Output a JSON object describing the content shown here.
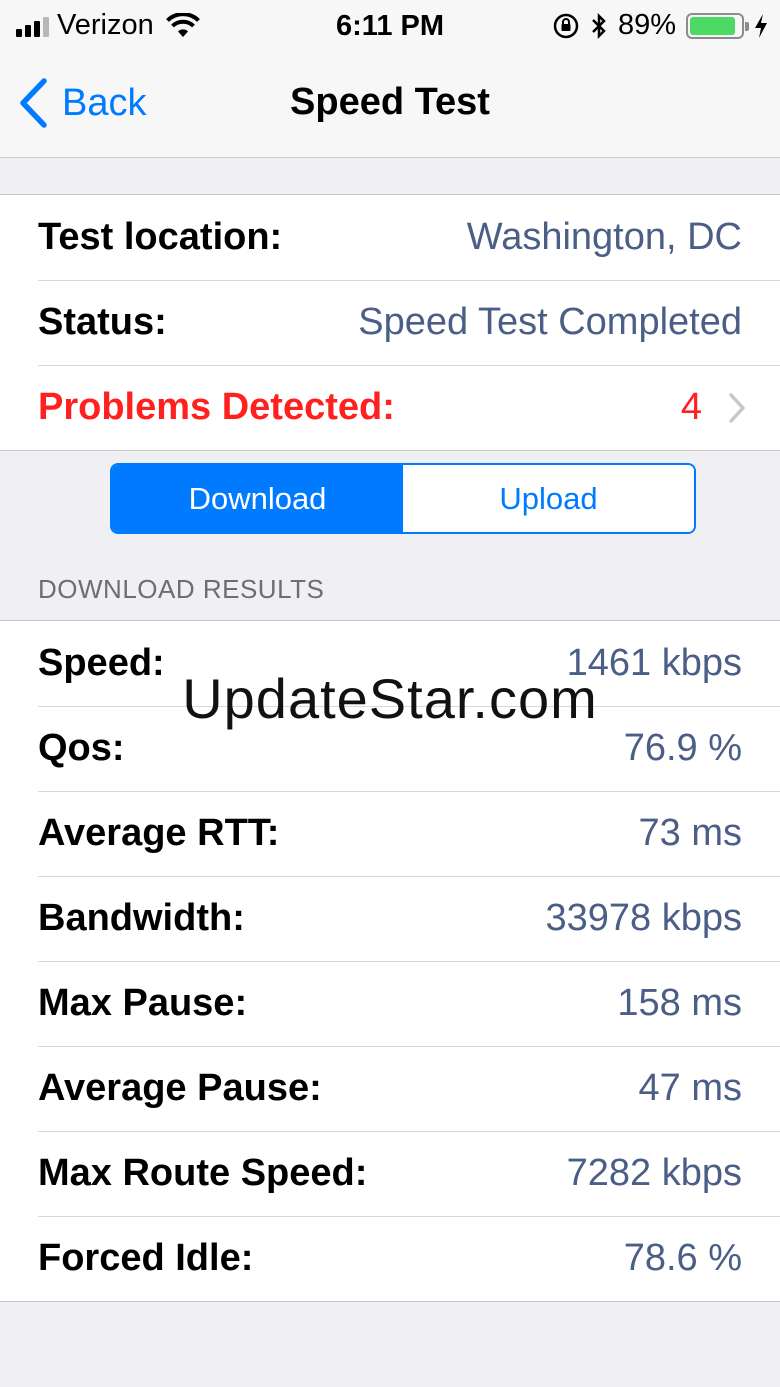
{
  "status_bar": {
    "carrier": "Verizon",
    "time": "6:11 PM",
    "battery_percent": "89%",
    "battery_level": 0.89
  },
  "nav": {
    "back_label": "Back",
    "title": "Speed Test"
  },
  "info": {
    "location_label": "Test location:",
    "location_value": "Washington, DC",
    "status_label": "Status:",
    "status_value": "Speed Test Completed",
    "problems_label": "Problems Detected:",
    "problems_value": "4"
  },
  "segmented": {
    "download": "Download",
    "upload": "Upload",
    "selected": "download"
  },
  "section_header": "DOWNLOAD RESULTS",
  "results": [
    {
      "label": "Speed:",
      "value": "1461 kbps"
    },
    {
      "label": "Qos:",
      "value": "76.9 %"
    },
    {
      "label": "Average RTT:",
      "value": "73 ms"
    },
    {
      "label": "Bandwidth:",
      "value": "33978 kbps"
    },
    {
      "label": "Max Pause:",
      "value": "158 ms"
    },
    {
      "label": "Average Pause:",
      "value": "47 ms"
    },
    {
      "label": "Max Route Speed:",
      "value": "7282 kbps"
    },
    {
      "label": "Forced Idle:",
      "value": "78.6 %"
    }
  ],
  "watermark": "UpdateStar.com",
  "colors": {
    "accent": "#007aff",
    "value_text": "#4a5e86",
    "alert": "#ff2020",
    "battery": "#4cd964"
  }
}
